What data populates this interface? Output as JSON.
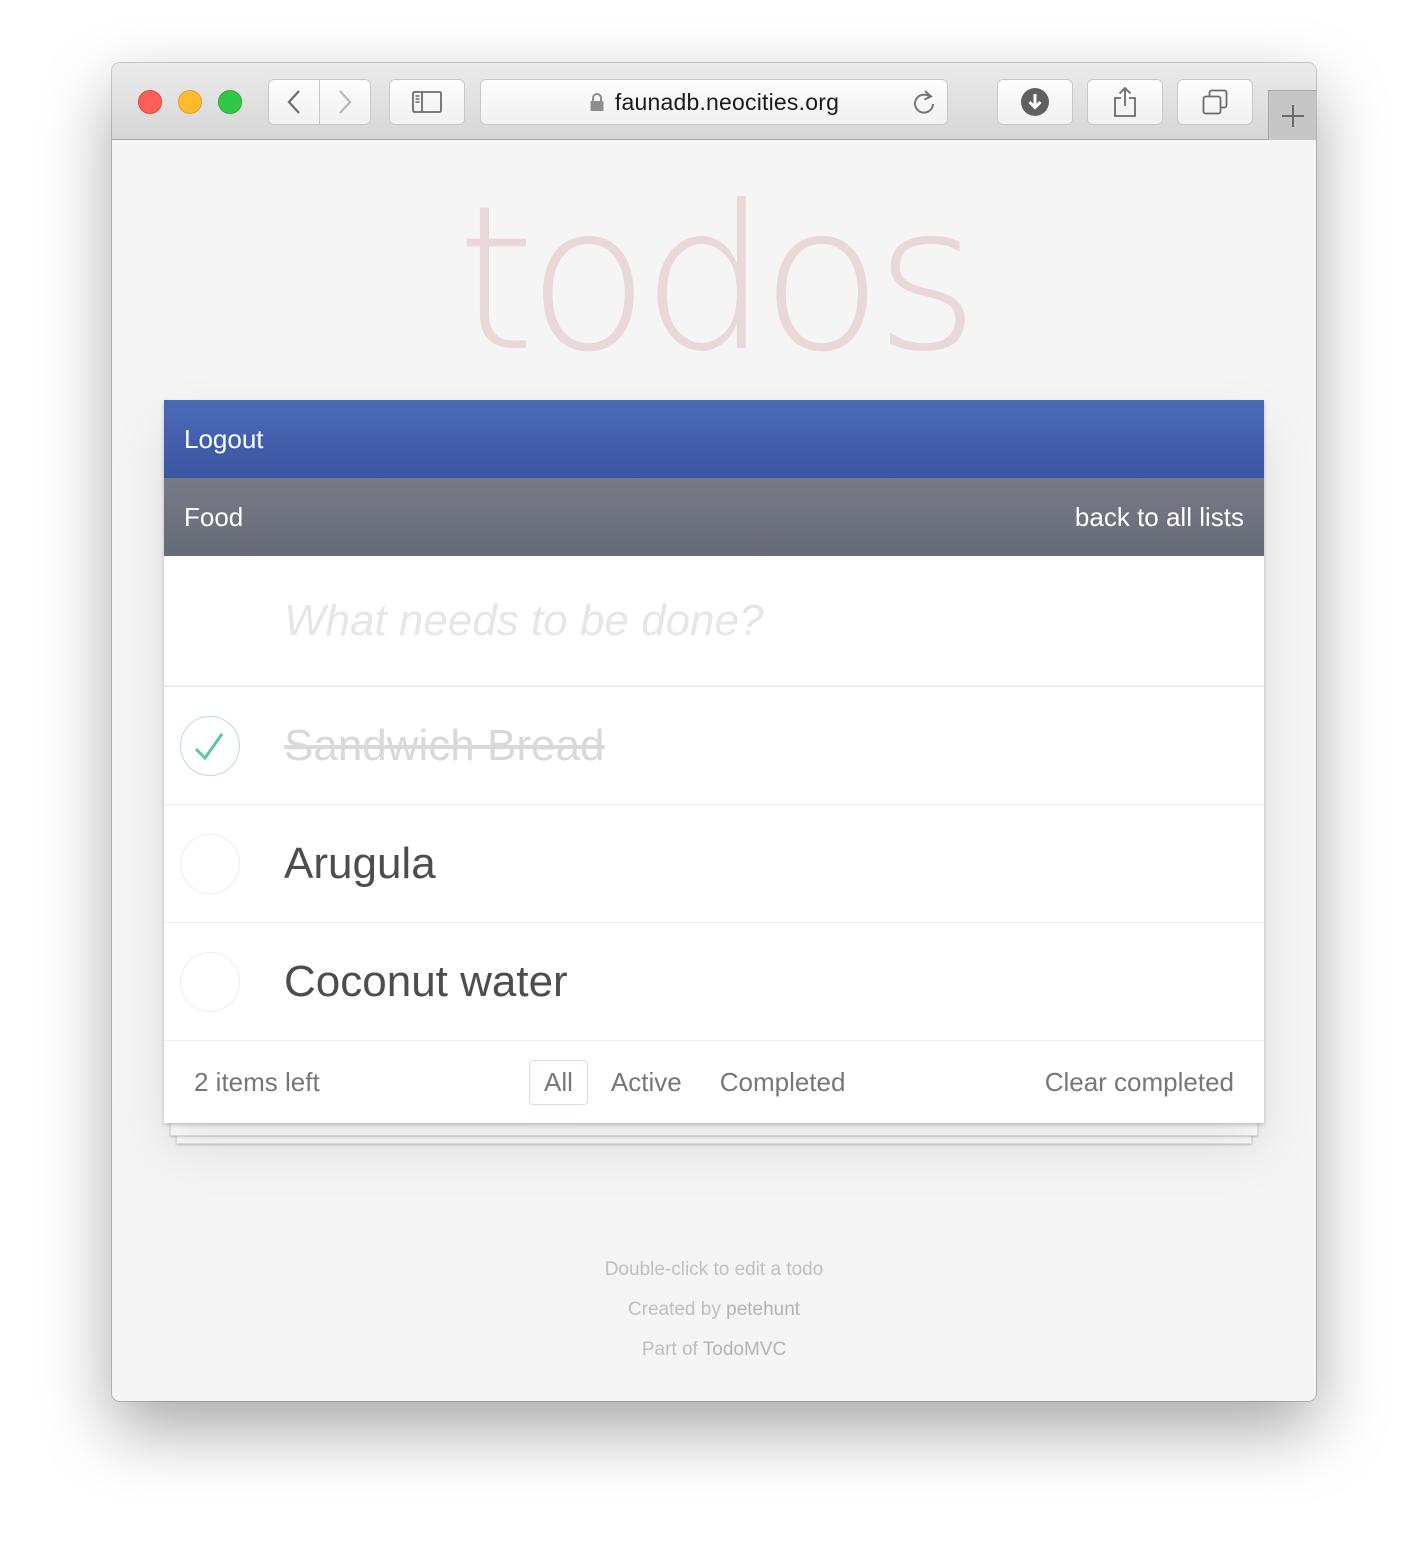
{
  "browser": {
    "url": "faunadb.neocities.org",
    "icons": {
      "back": "chevron-left-icon",
      "forward": "chevron-right-icon",
      "sidebar": "sidebar-icon",
      "lock": "lock-icon",
      "reload": "reload-icon",
      "download": "download-icon",
      "share": "share-icon",
      "tabs": "tabs-overview-icon",
      "new_tab": "plus-icon"
    }
  },
  "app": {
    "title": "todos",
    "logout_label": "Logout",
    "list_name": "Food",
    "back_link": "back to all lists",
    "new_todo_placeholder": "What needs to be done?",
    "todos": [
      {
        "label": "Sandwich Bread",
        "completed": true
      },
      {
        "label": "Arugula",
        "completed": false
      },
      {
        "label": "Coconut water",
        "completed": false
      }
    ],
    "footer": {
      "items_left": "2 items left",
      "filters": [
        {
          "label": "All",
          "selected": true
        },
        {
          "label": "Active",
          "selected": false
        },
        {
          "label": "Completed",
          "selected": false
        }
      ],
      "clear_completed": "Clear completed"
    },
    "info": {
      "hint": "Double-click to edit a todo",
      "created_prefix": "Created by",
      "created_author": "petehunt",
      "part_prefix": "Part of",
      "part_link": "TodoMVC"
    }
  },
  "colors": {
    "logout_bar": "#4566b0",
    "list_bar": "#6f7280",
    "title": "#ead7d7",
    "check": "#5dc2af",
    "selected_filter_border": "#efd6d6"
  }
}
